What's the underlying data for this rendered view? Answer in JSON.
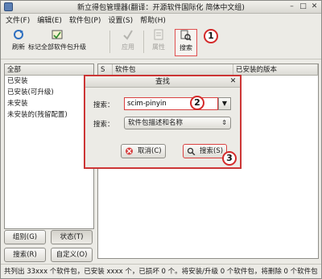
{
  "window": {
    "title": "新立得包管理器(翻译：开源软件国际化 简体中文组)"
  },
  "menubar": {
    "items": [
      "文件(F)",
      "编辑(E)",
      "软件包(P)",
      "设置(S)",
      "帮助(H)"
    ]
  },
  "toolbar": {
    "buttons": [
      {
        "label": "刷新",
        "icon": "refresh-icon",
        "enabled": true
      },
      {
        "label": "标记全部软件包升级",
        "icon": "mark-upgrade-icon",
        "enabled": true
      },
      {
        "label": "应用",
        "icon": "apply-checkmark-icon",
        "enabled": false
      },
      {
        "label": "属性",
        "icon": "properties-icon",
        "enabled": false
      },
      {
        "label": "搜索",
        "icon": "search-icon",
        "enabled": true
      }
    ]
  },
  "callouts": [
    "1",
    "2",
    "3"
  ],
  "sidebar": {
    "header": "全部",
    "items": [
      "已安装",
      "已安装(可升级)",
      "未安装",
      "未安装的(残留配置)"
    ],
    "buttons": [
      "组别(G)",
      "状态(T)",
      "搜索(R)",
      "自定义(O)"
    ]
  },
  "package_list": {
    "columns": [
      "S",
      "软件包",
      "已安装的版本"
    ]
  },
  "statusbar": {
    "text": "共列出 33xxx 个软件包，已安装 xxxx 个，已损坏 0 个。将安装/升级 0 个软件包，将删除 0 个软件包"
  },
  "search_dialog": {
    "title": "查找",
    "search_label": "搜索：",
    "search_value": "scim-pinyin",
    "look_in_label": "搜索：",
    "look_in_value": "软件包描述和名称",
    "cancel_label": "取消(C)",
    "search_button_label": "搜索(S)"
  },
  "colors": {
    "accent_red": "#d42a2a",
    "window_bg": "#ecebe6"
  }
}
